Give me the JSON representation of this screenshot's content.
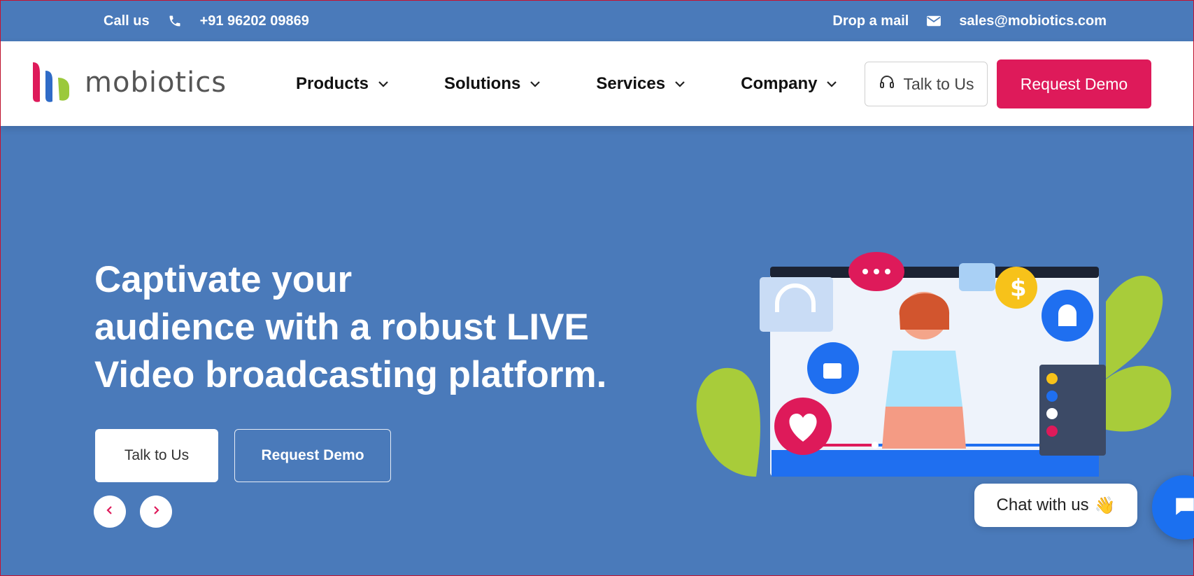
{
  "topbar": {
    "call_label": "Call us",
    "phone": "+91 96202 09869",
    "mail_label": "Drop a mail",
    "email": "sales@mobiotics.com"
  },
  "nav": {
    "logo_text": "mobiotics",
    "menu": [
      {
        "label": "Products"
      },
      {
        "label": "Solutions"
      },
      {
        "label": "Services"
      },
      {
        "label": "Company"
      }
    ],
    "talk_label": "Talk to Us",
    "demo_label": "Request Demo"
  },
  "hero": {
    "title_lines": [
      "Captivate your",
      "audience with a robust LIVE",
      "Video broadcasting platform."
    ],
    "talk_label": "Talk to Us",
    "demo_label": "Request Demo"
  },
  "chat": {
    "label": "Chat with us",
    "emoji": "👋"
  },
  "colors": {
    "brand_blue": "#4a7aba",
    "accent_pink": "#de1a5a",
    "chat_blue": "#1b70f0"
  }
}
